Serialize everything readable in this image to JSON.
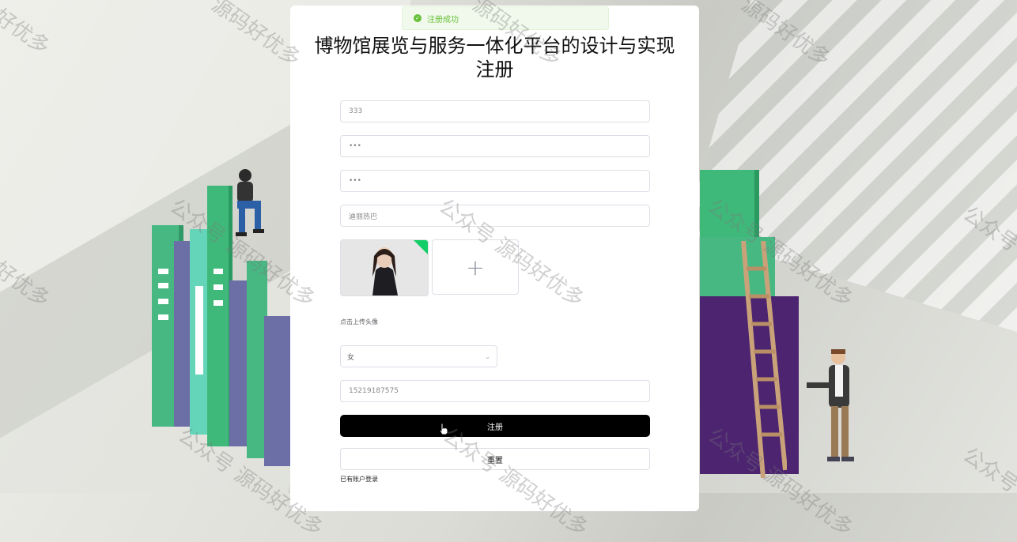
{
  "toast": {
    "message": "注册成功",
    "icon": "check-circle-icon",
    "color": "#67c23a"
  },
  "title": {
    "line1": "博物馆展览与服务一体化平台的设计与实现",
    "line2": "注册"
  },
  "form": {
    "account_value": "333",
    "password_value": "•••",
    "confirm_password_value": "•••",
    "name_value": "迪丽热巴",
    "avatar": {
      "upload_plus": "+",
      "hint": "点击上传头像"
    },
    "gender_value": "女",
    "phone_value": "15219187575",
    "register_label": "注册",
    "reset_label": "重置",
    "login_link": "已有账户登录"
  },
  "watermarks": [
    "公众号 源码好优多",
    "公众号 源码好优多",
    "公众号 源码好优多",
    "公众号 源码好优多",
    "公众号 源码好优多",
    "源码好优多",
    "好优多",
    "公众号",
    "公众号 源码好优多",
    "好优多"
  ],
  "colors": {
    "primary_button": "#000000",
    "success": "#67c23a",
    "avatar_badge": "#13ce66"
  }
}
